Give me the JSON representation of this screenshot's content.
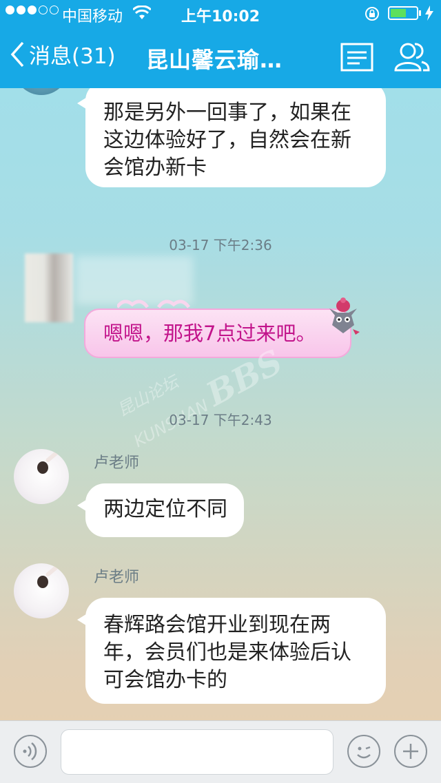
{
  "status_bar": {
    "carrier": "中国移动",
    "time": "上午10:02"
  },
  "nav": {
    "back_label": "消息(31)",
    "title": "昆山馨云瑜…"
  },
  "messages": [
    {
      "text_lines": [
        "那是另外一回事了，如果在",
        "这边体验好了，自然会在新",
        "会馆办新卡"
      ]
    },
    {
      "timestamp": "03-17 下午2:36"
    },
    {
      "outgoing_text": "嗯嗯，那我7点过来吧。"
    },
    {
      "timestamp": "03-17 下午2:43"
    },
    {
      "sender": "卢老师",
      "text_lines": [
        "两边定位不同"
      ]
    },
    {
      "sender": "卢老师",
      "text_lines": [
        "春辉路会馆开业到现在两",
        "年，会员们也是来体验后认",
        "可会馆办卡的"
      ]
    }
  ],
  "watermark": {
    "line1": "昆山论坛",
    "line2": "KUNSHAN",
    "logo": "BBS"
  },
  "input": {
    "value": "",
    "placeholder": ""
  },
  "colors": {
    "nav_blue": "#17a9e6",
    "pink_text": "#c2148b",
    "timestamp": "#6b7d86"
  }
}
